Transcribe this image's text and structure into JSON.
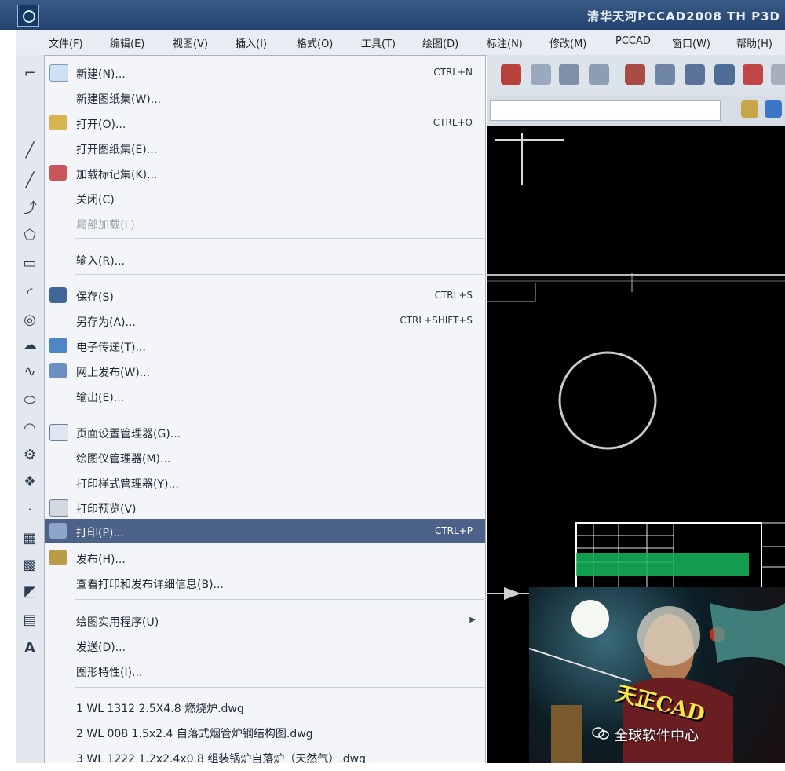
{
  "window": {
    "title": "清华天河PCCAD2008 TH P3D"
  },
  "menubar": {
    "items": [
      "文件(F)",
      "编辑(E)",
      "视图(V)",
      "插入(I)",
      "格式(O)",
      "工具(T)",
      "绘图(D)",
      "标注(N)",
      "修改(M)",
      "PCCAD",
      "窗口(W)",
      "帮助(H)"
    ]
  },
  "file_menu": {
    "items": [
      {
        "label": "新建(N)...",
        "shortcut": "CTRL+N"
      },
      {
        "label": "新建图纸集(W)...",
        "shortcut": ""
      },
      {
        "label": "打开(O)...",
        "shortcut": "CTRL+O"
      },
      {
        "label": "打开图纸集(E)...",
        "shortcut": ""
      },
      {
        "label": "加载标记集(K)...",
        "shortcut": ""
      },
      {
        "label": "关闭(C)",
        "shortcut": ""
      },
      {
        "label": "局部加载(L)",
        "shortcut": ""
      },
      {
        "label": "输入(R)...",
        "shortcut": ""
      },
      {
        "label": "保存(S)",
        "shortcut": "CTRL+S"
      },
      {
        "label": "另存为(A)...",
        "shortcut": "CTRL+SHIFT+S"
      },
      {
        "label": "电子传递(T)...",
        "shortcut": ""
      },
      {
        "label": "网上发布(W)...",
        "shortcut": ""
      },
      {
        "label": "输出(E)...",
        "shortcut": ""
      },
      {
        "label": "页面设置管理器(G)...",
        "shortcut": ""
      },
      {
        "label": "绘图仪管理器(M)...",
        "shortcut": ""
      },
      {
        "label": "打印样式管理器(Y)...",
        "shortcut": ""
      },
      {
        "label": "打印预览(V)",
        "shortcut": ""
      },
      {
        "label": "打印(P)...",
        "shortcut": "CTRL+P"
      },
      {
        "label": "发布(H)...",
        "shortcut": ""
      },
      {
        "label": "查看打印和发布详细信息(B)...",
        "shortcut": ""
      },
      {
        "label": "绘图实用程序(U)",
        "shortcut": ""
      },
      {
        "label": "发送(D)...",
        "shortcut": ""
      },
      {
        "label": "图形特性(I)...",
        "shortcut": ""
      },
      {
        "label": "1 WL 1312 2.5X4.8 燃烧炉.dwg",
        "shortcut": ""
      },
      {
        "label": "2 WL 008 1.5x2.4 自落式烟管炉钢结构图.dwg",
        "shortcut": ""
      },
      {
        "label": "3 WL 1222 1.2x2.4x0.8 组装锅炉自落炉（天然气）.dwg",
        "shortcut": ""
      }
    ]
  },
  "splash": {
    "text": "天正CAD"
  },
  "watermark": {
    "text": "全球软件中心"
  },
  "colors": {
    "selection": "#4d6288",
    "canvas": "#000000",
    "titlebar": "#2d4d79"
  }
}
